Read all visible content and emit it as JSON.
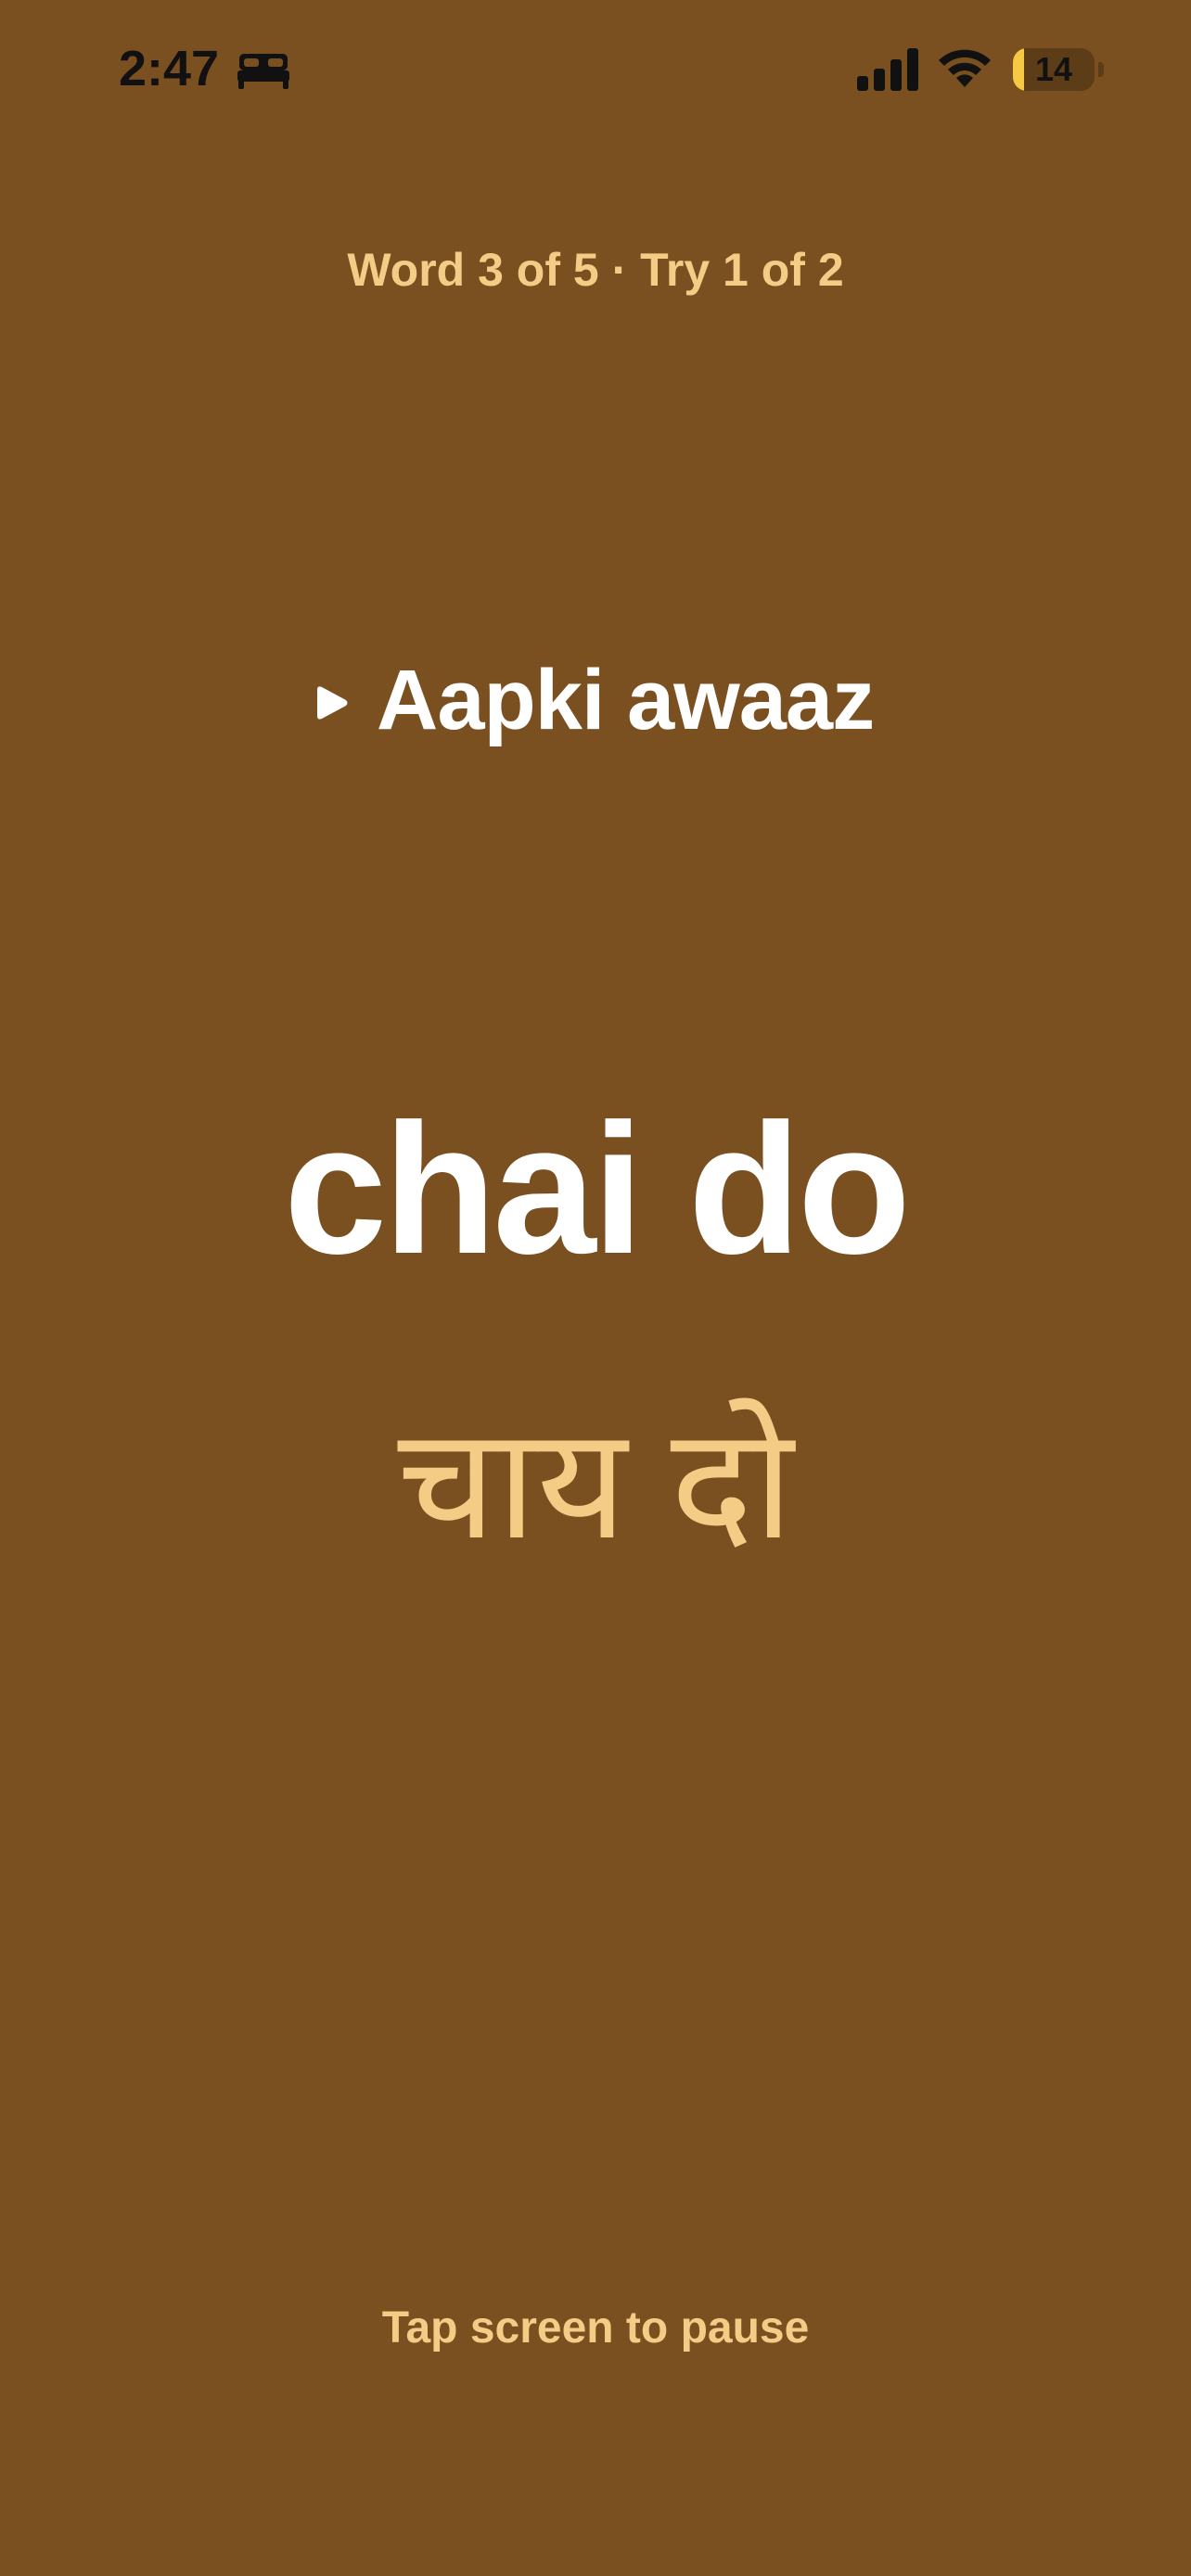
{
  "status_bar": {
    "time": "2:47",
    "focus_icon": "bed-icon",
    "signal_icon": "cellular-signal-icon",
    "wifi_icon": "wifi-icon",
    "battery_level": "14",
    "battery_fraction": 0.14,
    "battery_color": "#f6c945"
  },
  "session": {
    "progress": "Word 3 of 5 · Try 1 of 2"
  },
  "speaker": {
    "icon": "play-icon",
    "label": "Aapki awaaz"
  },
  "word": {
    "romanized": "chai do",
    "native": "चाय दो"
  },
  "footer": {
    "hint": "Tap screen to pause"
  },
  "colors": {
    "background": "#7b5020",
    "accent": "#f5cc86",
    "primary_text": "#ffffff"
  }
}
